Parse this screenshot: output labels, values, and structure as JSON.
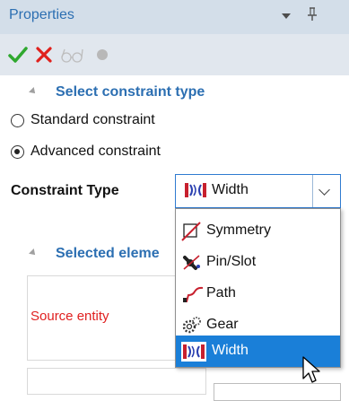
{
  "panel": {
    "title": "Properties"
  },
  "section_constraint": {
    "title": "Select constraint type",
    "options": [
      {
        "label": "Standard constraint",
        "checked": false
      },
      {
        "label": "Advanced constraint",
        "checked": true
      }
    ]
  },
  "constraint_type": {
    "label": "Constraint Type",
    "selected": "Width",
    "items": [
      {
        "label": "Symmetry",
        "icon": "symmetry-icon",
        "selected": false
      },
      {
        "label": "Pin/Slot",
        "icon": "pin-slot-icon",
        "selected": false
      },
      {
        "label": "Path",
        "icon": "path-icon",
        "selected": false
      },
      {
        "label": "Gear",
        "icon": "gear-icon",
        "selected": false
      },
      {
        "label": "Width",
        "icon": "width-icon",
        "selected": true
      }
    ]
  },
  "section_selected": {
    "title": "Selected eleme"
  },
  "source_entity": {
    "label": "Source entity"
  },
  "colors": {
    "accent": "#2c6fb2",
    "selection": "#1a7fd8",
    "error": "#e02020",
    "ok": "#2fa82f",
    "cancel": "#e0211c"
  }
}
